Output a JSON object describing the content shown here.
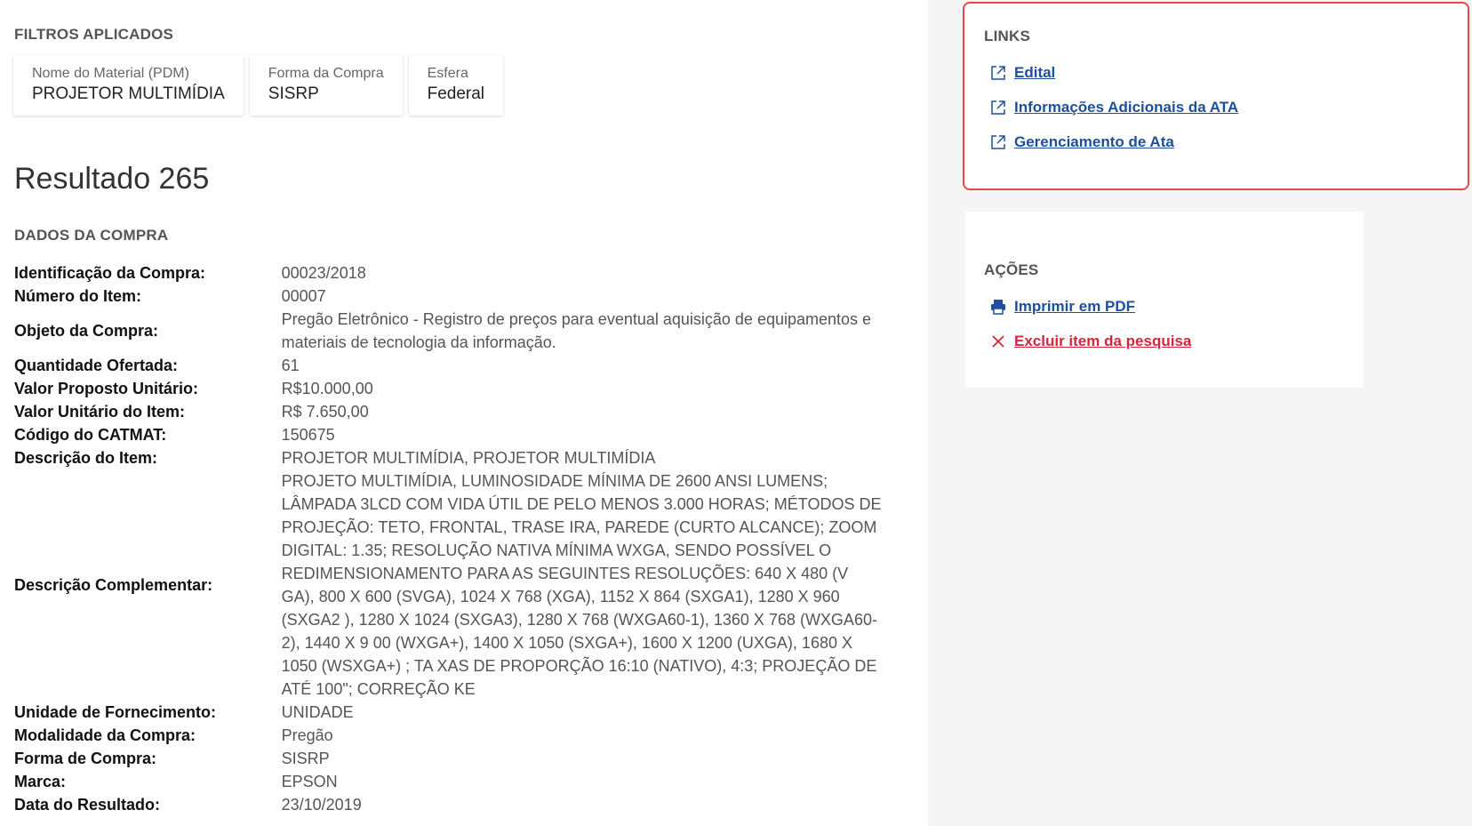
{
  "filters": {
    "heading": "FILTROS APLICADOS",
    "chips": [
      {
        "label": "Nome do Material (PDM)",
        "value": "PROJETOR MULTIMÍDIA"
      },
      {
        "label": "Forma da Compra",
        "value": "SISRP"
      },
      {
        "label": "Esfera",
        "value": "Federal"
      }
    ]
  },
  "result": {
    "title": "Resultado 265",
    "section_heading": "DADOS DA COMPRA",
    "rows": [
      {
        "label": "Identificação da Compra:",
        "value": [
          "00023/2018"
        ]
      },
      {
        "label": "Número do Item:",
        "value": [
          "00007"
        ]
      },
      {
        "label": "Objeto da Compra:",
        "value": [
          "Pregão Eletrônico - Registro de preços para eventual aquisição de equipamentos e",
          "materiais de tecnologia da informação."
        ]
      },
      {
        "label": "Quantidade Ofertada:",
        "value": [
          "61"
        ]
      },
      {
        "label": "Valor Proposto Unitário:",
        "value": [
          "R$10.000,00"
        ]
      },
      {
        "label": "Valor Unitário do Item:",
        "value": [
          "R$ 7.650,00"
        ]
      },
      {
        "label": "Código do CATMAT:",
        "value": [
          "150675"
        ]
      },
      {
        "label": "Descrição do Item:",
        "value": [
          "PROJETOR MULTIMÍDIA, PROJETOR MULTIMÍDIA"
        ]
      },
      {
        "label": "Descrição Complementar:",
        "value": [
          "PROJETO MULTIMÍDIA, LUMINOSIDADE MÍNIMA DE 2600 ANSI LUMENS;",
          "LÂMPADA 3LCD COM VIDA ÚTIL DE PELO MENOS 3.000 HORAS; MÉTODOS DE",
          "PROJEÇÃO: TETO, FRONTAL, TRASE IRA, PAREDE (CURTO ALCANCE); ZOOM",
          "DIGITAL: 1.35; RESOLUÇÃO NATIVA MÍNIMA WXGA, SENDO POSSÍVEL O",
          "REDIMENSIONAMENTO PARA AS SEGUINTES RESOLUÇÕES: 640 X 480 (V",
          "GA), 800 X 600 (SVGA), 1024 X 768 (XGA), 1152 X 864 (SXGA1), 1280 X 960",
          "(SXGA2 ), 1280 X 1024 (SXGA3), 1280 X 768 (WXGA60-1), 1360 X 768 (WXGA60-",
          "2), 1440 X 9 00 (WXGA+), 1400 X 1050 (SXGA+), 1600 X 1200 (UXGA), 1680 X",
          "1050 (WSXGA+) ; TA XAS DE PROPORÇÃO 16:10 (NATIVO), 4:3; PROJEÇÃO DE",
          "ATÉ 100\"; CORREÇÃO KE"
        ]
      },
      {
        "label": "Unidade de Fornecimento:",
        "value": [
          "UNIDADE"
        ]
      },
      {
        "label": "Modalidade da Compra:",
        "value": [
          "Pregão"
        ]
      },
      {
        "label": "Forma de Compra:",
        "value": [
          "SISRP"
        ]
      },
      {
        "label": "Marca:",
        "value": [
          "EPSON"
        ]
      },
      {
        "label": "Data do Resultado:",
        "value": [
          "23/10/2019"
        ]
      }
    ]
  },
  "links": {
    "heading": "LINKS",
    "items": [
      {
        "label": " Edital",
        "icon": "external-link-icon"
      },
      {
        "label": " Informações Adicionais da ATA",
        "icon": "external-link-icon"
      },
      {
        "label": " Gerenciamento de Ata",
        "icon": "external-link-icon"
      }
    ]
  },
  "acoes": {
    "heading": "AÇÕES",
    "print_label": " Imprimir em PDF",
    "print_icon": "printer-icon",
    "delete_label": " Excluir item da pesquisa",
    "delete_icon": "close-icon"
  },
  "colors": {
    "link": "#1f4f9c",
    "danger": "#d4283a",
    "highlight_border": "#e8474f",
    "sidebar_bg": "#f5f5f5"
  }
}
